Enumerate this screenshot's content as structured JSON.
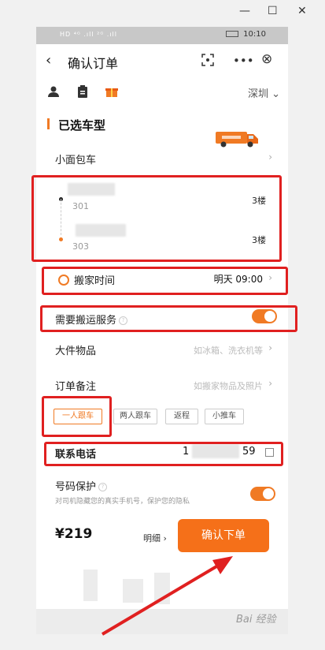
{
  "window": {
    "minimize": "—",
    "maximize": "☐",
    "close": "✕"
  },
  "status_bar": {
    "left": "HD ⁴ᴳ .ıll ²ᴳ .ıll",
    "time": "10:10"
  },
  "header": {
    "back": "‹",
    "title": "确认订单",
    "scan_icon": "scan-icon",
    "more": "•••",
    "close": "⊗"
  },
  "toolbar": {
    "city": "深圳",
    "city_chevron": "⌄"
  },
  "vehicle": {
    "section_title": "已选车型",
    "type": "小面包车",
    "chevron": "›"
  },
  "addresses": [
    {
      "sub": "301",
      "floor": "3楼",
      "dot_color": "#222222"
    },
    {
      "sub": "303",
      "floor": "3楼",
      "dot_color": "#f07a24"
    }
  ],
  "move_time": {
    "label": "搬家时间",
    "value": "明天 09:00",
    "chevron": "›"
  },
  "service": {
    "label": "需要搬运服务",
    "help": "?",
    "enabled": true
  },
  "big_items": {
    "label": "大件物品",
    "hint": "如冰箱、洗衣机等",
    "chevron": "›"
  },
  "remark": {
    "label": "订单备注",
    "hint": "如搬家物品及照片",
    "chevron": "›"
  },
  "tags": [
    {
      "label": "一人跟车",
      "selected": true
    },
    {
      "label": "两人跟车",
      "selected": false
    },
    {
      "label": "返程",
      "selected": false
    },
    {
      "label": "小推车",
      "selected": false
    }
  ],
  "contact": {
    "label": "联系电话",
    "prefix": "1",
    "suffix": "59"
  },
  "privacy": {
    "label": "号码保护",
    "help": "?",
    "desc": "对司机隐藏您的真实手机号，保护您的隐私",
    "enabled": true
  },
  "footer": {
    "price": "¥219",
    "detail": "明细 ›",
    "confirm": "确认下单"
  },
  "watermark": "Bai 经验",
  "colors": {
    "accent": "#f07a24",
    "highlight": "#e02020"
  }
}
